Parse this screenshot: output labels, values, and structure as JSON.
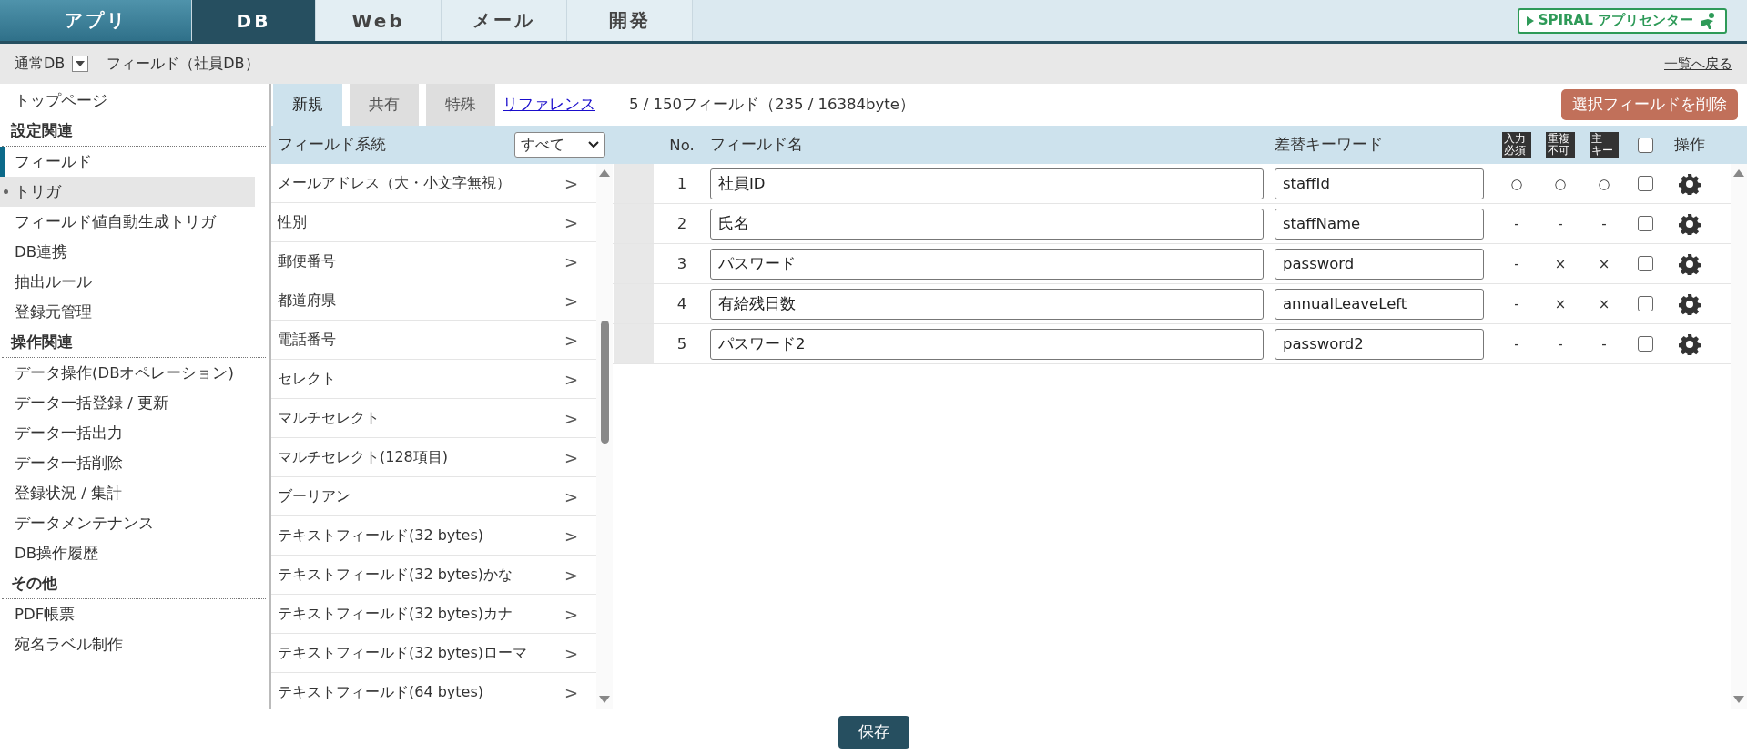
{
  "nav": {
    "tabs": [
      {
        "label": "アプリ",
        "kind": "app",
        "selected": false
      },
      {
        "label": "DB",
        "kind": "db",
        "selected": true
      },
      {
        "label": "Web",
        "kind": "plain",
        "selected": false
      },
      {
        "label": "メール",
        "kind": "plain",
        "selected": false
      },
      {
        "label": "開発",
        "kind": "plain",
        "selected": false
      }
    ],
    "logo": "SPIRAL アプリセンター"
  },
  "subheader": {
    "db_type": "通常DB",
    "title": "フィールド（社員DB）",
    "back_link": "一覧へ戻る"
  },
  "sidebar": {
    "top": "トップページ",
    "groups": [
      {
        "heading": "設定関連",
        "items": [
          {
            "label": "フィールド",
            "selected": true,
            "highlighted": false
          },
          {
            "label": "トリガ",
            "selected": false,
            "highlighted": true
          },
          {
            "label": "フィールド値自動生成トリガ",
            "selected": false,
            "highlighted": false
          },
          {
            "label": "DB連携",
            "selected": false,
            "highlighted": false
          },
          {
            "label": "抽出ルール",
            "selected": false,
            "highlighted": false
          },
          {
            "label": "登録元管理",
            "selected": false,
            "highlighted": false
          }
        ]
      },
      {
        "heading": "操作関連",
        "items": [
          {
            "label": "データ操作(DBオペレーション)",
            "selected": false,
            "highlighted": false
          },
          {
            "label": "データ一括登録 / 更新",
            "selected": false,
            "highlighted": false
          },
          {
            "label": "データ一括出力",
            "selected": false,
            "highlighted": false
          },
          {
            "label": "データ一括削除",
            "selected": false,
            "highlighted": false
          },
          {
            "label": "登録状況 / 集計",
            "selected": false,
            "highlighted": false
          },
          {
            "label": "データメンテナンス",
            "selected": false,
            "highlighted": false
          },
          {
            "label": "DB操作履歴",
            "selected": false,
            "highlighted": false
          }
        ]
      },
      {
        "heading": "その他",
        "items": [
          {
            "label": "PDF帳票",
            "selected": false,
            "highlighted": false
          },
          {
            "label": "宛名ラベル制作",
            "selected": false,
            "highlighted": false
          }
        ]
      }
    ]
  },
  "field_types": {
    "tabs": [
      {
        "label": "新規",
        "kind": "tab",
        "selected": true
      },
      {
        "label": "共有",
        "kind": "tab",
        "selected": false
      },
      {
        "label": "特殊",
        "kind": "tab",
        "selected": false
      },
      {
        "label": "リファレンス",
        "kind": "link"
      }
    ],
    "filter_label": "フィールド系統",
    "filter_value": "すべて",
    "items": [
      {
        "label": "メールアドレス（大・小文字無視）",
        "arrow": ">"
      },
      {
        "label": "性別",
        "arrow": ">"
      },
      {
        "label": "郵便番号",
        "arrow": ">"
      },
      {
        "label": "都道府県",
        "arrow": ">"
      },
      {
        "label": "電話番号",
        "arrow": ">"
      },
      {
        "label": "セレクト",
        "arrow": ">"
      },
      {
        "label": "マルチセレクト",
        "arrow": ">"
      },
      {
        "label": "マルチセレクト(128項目)",
        "arrow": ">"
      },
      {
        "label": "ブーリアン",
        "arrow": ">"
      },
      {
        "label": "テキストフィールド(32 bytes)",
        "arrow": ">"
      },
      {
        "label": "テキストフィールド(32 bytes)かな",
        "arrow": ">"
      },
      {
        "label": "テキストフィールド(32 bytes)カナ",
        "arrow": ">"
      },
      {
        "label": "テキストフィールド(32 bytes)ローマ",
        "arrow": ">"
      },
      {
        "label": "テキストフィールド(64 bytes)",
        "arrow": ">"
      }
    ]
  },
  "fields": {
    "summary": "5 / 150フィールド（235 / 16384byte）",
    "delete_button": "選択フィールドを削除",
    "columns": {
      "no": "No.",
      "name": "フィールド名",
      "keyword": "差替キーワード",
      "flags": [
        [
          "入力",
          "必須"
        ],
        [
          "重複",
          "不可"
        ],
        [
          "主",
          "キー"
        ]
      ],
      "select_all_checked": false,
      "action": "操作"
    },
    "rows": [
      {
        "no": "1",
        "name": "社員ID",
        "keyword": "staffId",
        "flags": [
          "○",
          "○",
          "○"
        ],
        "checked": false
      },
      {
        "no": "2",
        "name": "氏名",
        "keyword": "staffName",
        "flags": [
          "-",
          "-",
          "-"
        ],
        "checked": false
      },
      {
        "no": "3",
        "name": "パスワード",
        "keyword": "password",
        "flags": [
          "-",
          "×",
          "×"
        ],
        "checked": false
      },
      {
        "no": "4",
        "name": "有給残日数",
        "keyword": "annualLeaveLeft",
        "flags": [
          "-",
          "×",
          "×"
        ],
        "checked": false
      },
      {
        "no": "5",
        "name": "パスワード2",
        "keyword": "password2",
        "flags": [
          "-",
          "-",
          "-"
        ],
        "checked": false
      }
    ]
  },
  "footer": {
    "save_button": "保存"
  }
}
